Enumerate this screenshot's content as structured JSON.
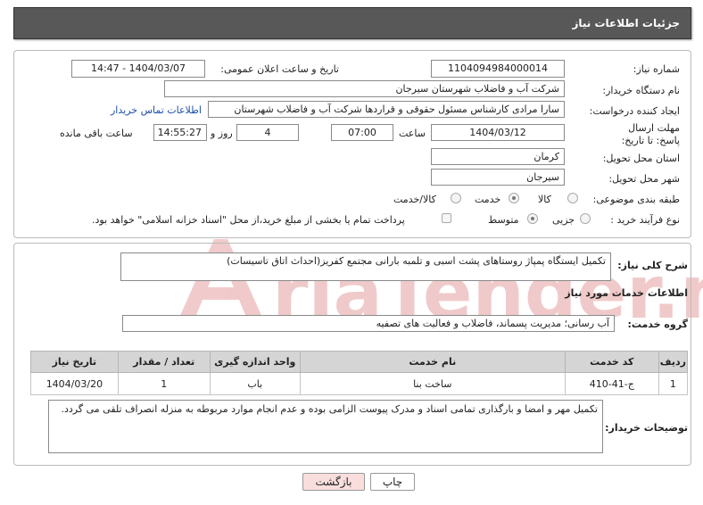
{
  "header": {
    "title": "جزئیات اطلاعات نیاز"
  },
  "form": {
    "need_number_label": "شماره نیاز:",
    "need_number": "1104094984000014",
    "announce_label": "تاریخ و ساعت اعلان عمومی:",
    "announce_value": "1404/03/07 - 14:47",
    "buyer_org_label": "نام دستگاه خریدار:",
    "buyer_org": "شرکت آب و فاضلاب شهرستان سیرجان",
    "creator_label": "ایجاد کننده درخواست:",
    "creator": "سارا مرادی کارشناس مسئول حقوقی و قراردها شرکت آب و فاضلاب شهرستان",
    "contact_link": "اطلاعات تماس خریدار",
    "deadline_label": "مهلت ارسال پاسخ: تا تاریخ:",
    "deadline_date": "1404/03/12",
    "time_label": "ساعت",
    "deadline_time": "07:00",
    "days_value": "4",
    "days_label": "روز و",
    "remaining_time": "14:55:27",
    "remaining_label": "ساعت باقی مانده",
    "province_label": "استان محل تحویل:",
    "province": "کرمان",
    "city_label": "شهر محل تحویل:",
    "city": "سیرجان",
    "category_label": "طبقه بندی موضوعی:",
    "category_options": [
      "کالا",
      "خدمت",
      "کالا/خدمت"
    ],
    "process_label": "نوع فرآیند خرید :",
    "process_options": [
      "جزیی",
      "متوسط"
    ],
    "payment_note": "پرداخت تمام یا بخشی از مبلغ خرید،از محل \"اسناد خزانه اسلامی\" خواهد بود."
  },
  "details": {
    "summary_label": "شرح کلی نیاز:",
    "summary": "تکمیل ایستگاه پمپاژ روستاهای پشت اسبی و تلمبه بارانی مجتمع کفریز(احداث اتاق تاسیسات)",
    "services_heading": "اطلاعات خدمات مورد نیاز",
    "group_label": "گروه خدمت:",
    "group_value": "آب رسانی؛ مدیریت پسماند، فاضلاب و فعالیت های تصفیه",
    "table": {
      "headers": [
        "ردیف",
        "کد خدمت",
        "نام خدمت",
        "واحد اندازه گیری",
        "تعداد / مقدار",
        "تاریخ نیاز"
      ],
      "rows": [
        [
          "1",
          "ج-41-410",
          "ساخت بنا",
          "باب",
          "1",
          "1404/03/20"
        ]
      ]
    },
    "buyer_notes_label": "توضیحات خریدار:",
    "buyer_notes": "تکمیل مهر و امضا و بارگذاری تمامی اسناد و مدرک پیوست الزامی بوده و عدم انجام موارد مربوطه به منزله انصراف تلقی می گردد."
  },
  "buttons": {
    "print": "چاپ",
    "back": "بازگشت"
  },
  "watermark_text": "AriaTender.neT",
  "colors": {
    "header_bg": "#585858",
    "link": "#1b4fa8",
    "back_bg": "#f9dede",
    "watermark": "#e8b9b9"
  }
}
